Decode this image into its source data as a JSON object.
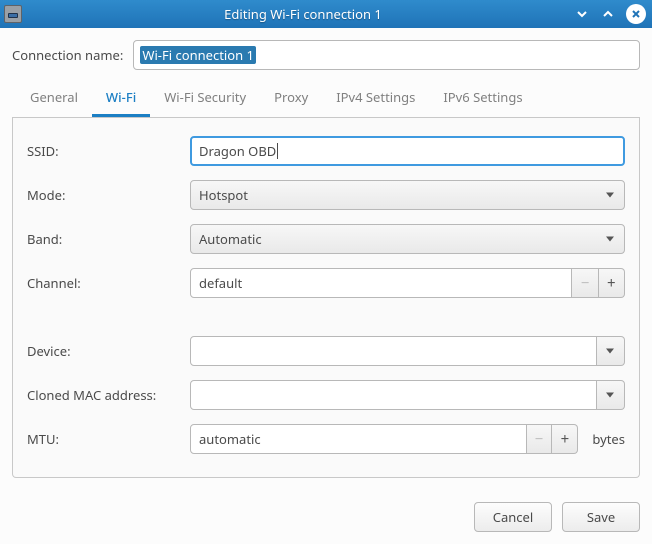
{
  "window": {
    "title": "Editing Wi-Fi connection 1"
  },
  "connection_name": {
    "label": "Connection name:",
    "value": "Wi-Fi connection 1"
  },
  "tabs": [
    {
      "id": "general",
      "label": "General"
    },
    {
      "id": "wifi",
      "label": "Wi-Fi"
    },
    {
      "id": "wifisec",
      "label": "Wi-Fi Security"
    },
    {
      "id": "proxy",
      "label": "Proxy"
    },
    {
      "id": "ipv4",
      "label": "IPv4 Settings"
    },
    {
      "id": "ipv6",
      "label": "IPv6 Settings"
    }
  ],
  "active_tab": "wifi",
  "wifi": {
    "ssid": {
      "label": "SSID:",
      "value": "Dragon OBD"
    },
    "mode": {
      "label": "Mode:",
      "value": "Hotspot"
    },
    "band": {
      "label": "Band:",
      "value": "Automatic"
    },
    "channel": {
      "label": "Channel:",
      "value": "default"
    },
    "device": {
      "label": "Device:",
      "value": ""
    },
    "cloned_mac": {
      "label": "Cloned MAC address:",
      "value": ""
    },
    "mtu": {
      "label": "MTU:",
      "value": "automatic",
      "suffix": "bytes"
    }
  },
  "footer": {
    "cancel": "Cancel",
    "save": "Save"
  },
  "glyphs": {
    "minus": "−",
    "plus": "+"
  }
}
